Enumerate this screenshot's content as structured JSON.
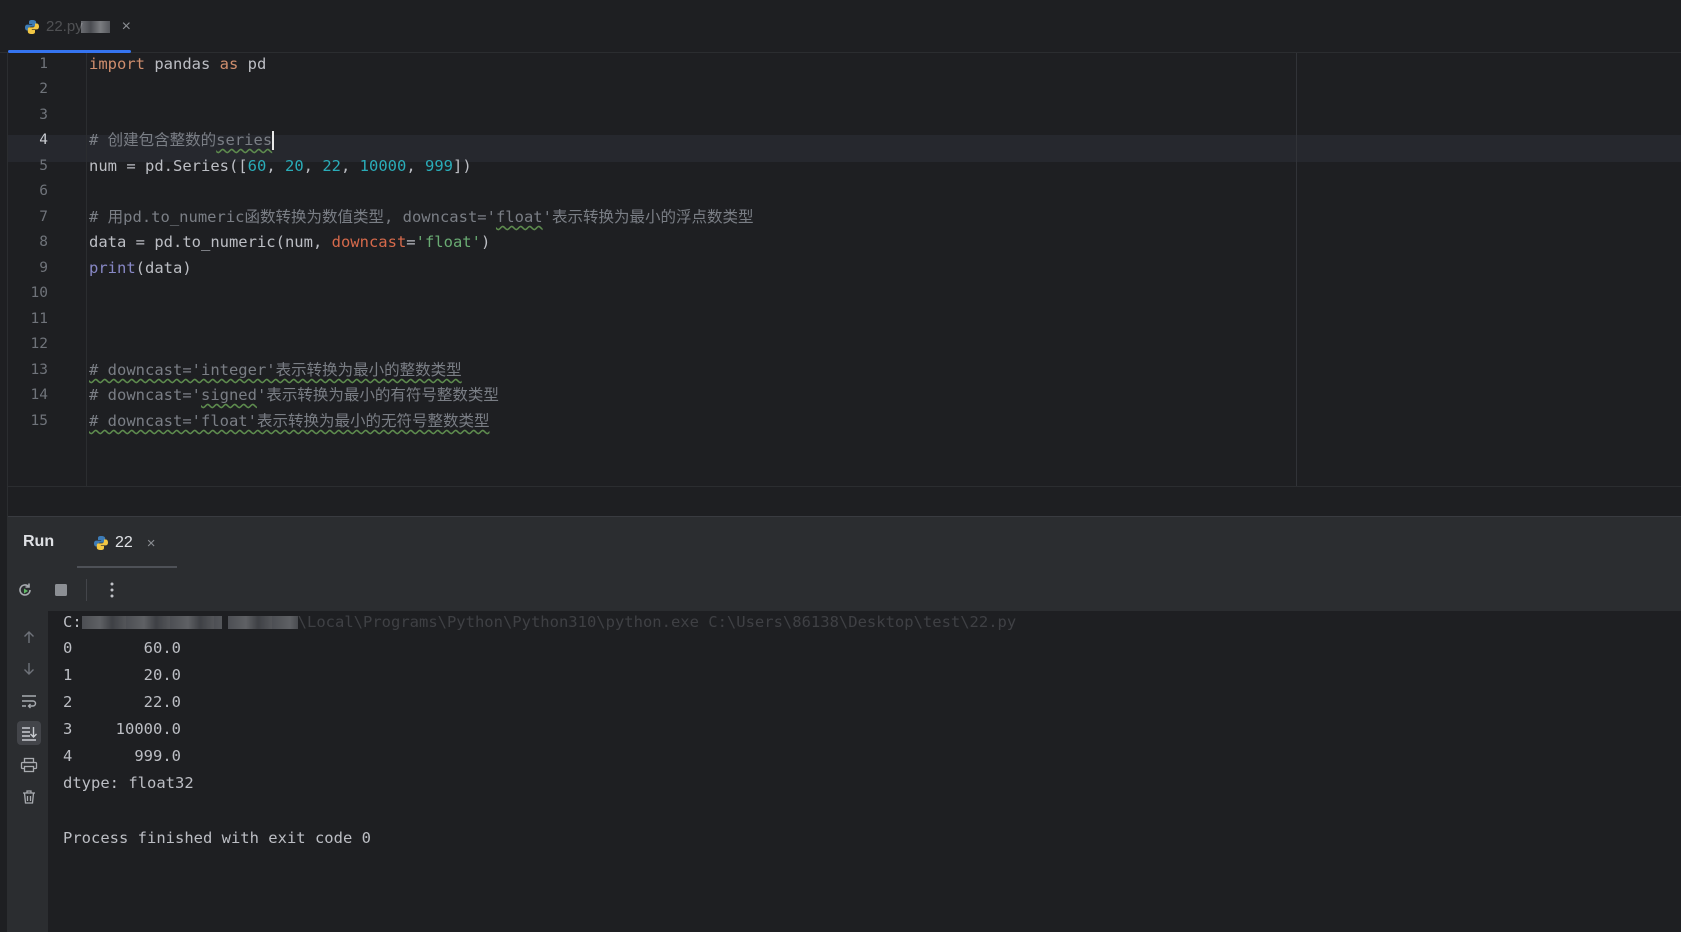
{
  "editor_tab": {
    "label": "22.py",
    "close": "×"
  },
  "code_lines": [
    {
      "n": "1"
    },
    {
      "n": "2"
    },
    {
      "n": "3"
    },
    {
      "n": "4"
    },
    {
      "n": "5"
    },
    {
      "n": "6"
    },
    {
      "n": "7"
    },
    {
      "n": "8"
    },
    {
      "n": "9"
    },
    {
      "n": "10"
    },
    {
      "n": "11"
    },
    {
      "n": "12"
    },
    {
      "n": "13"
    },
    {
      "n": "14"
    },
    {
      "n": "15"
    }
  ],
  "code": {
    "l1": {
      "kw1": "import",
      "mod": " pandas ",
      "kw2": "as",
      "alias": " pd"
    },
    "l4": {
      "comment_a": "# 创建包含整数的",
      "comment_b": "series"
    },
    "l5": {
      "a": "num = pd.Series([",
      "n1": "60",
      "c1": ", ",
      "n2": "20",
      "c2": ", ",
      "n3": "22",
      "c3": ", ",
      "n4": "10000",
      "c4": ", ",
      "n5": "999",
      "end": "])"
    },
    "l7": {
      "a": "# 用pd.to_numeric函数转换为数值类型, downcast='",
      "b": "float",
      "c": "'表示转换为最小的浮点数类型"
    },
    "l8": {
      "a": "data = pd.to_numeric(num, ",
      "param": "downcast",
      "eq": "=",
      "str": "'float'",
      "end": ")"
    },
    "l9": {
      "fn": "print",
      "rest": "(data)"
    },
    "l13": {
      "text": "# downcast='integer'表示转换为最小的整数类型"
    },
    "l14": {
      "a": "# downcast='",
      "b": "signed",
      "c": "'表示转换为最小的有符号整数类型"
    },
    "l15": {
      "text": "# downcast='float'表示转换为最小的无符号整数类型"
    }
  },
  "run_panel": {
    "title": "Run",
    "tab_label": "22",
    "tab_close": "×"
  },
  "console": {
    "cmd_prefix": "C:",
    "cmd_tail": "\\Local\\Programs\\Python\\Python310\\python.exe C:\\Users\\86138\\Desktop\\test\\22.py",
    "rows": [
      {
        "idx": "0",
        "val": "60.0"
      },
      {
        "idx": "1",
        "val": "20.0"
      },
      {
        "idx": "2",
        "val": "22.0"
      },
      {
        "idx": "3",
        "val": "10000.0"
      },
      {
        "idx": "4",
        "val": "999.0"
      }
    ],
    "dtype": "dtype: float32",
    "exit": "Process finished with exit code 0"
  },
  "colors": {
    "accent": "#3574f0",
    "keyword": "#cf8e6d",
    "number": "#2aacb8",
    "string": "#6aab73",
    "comment": "#7a7e85"
  }
}
